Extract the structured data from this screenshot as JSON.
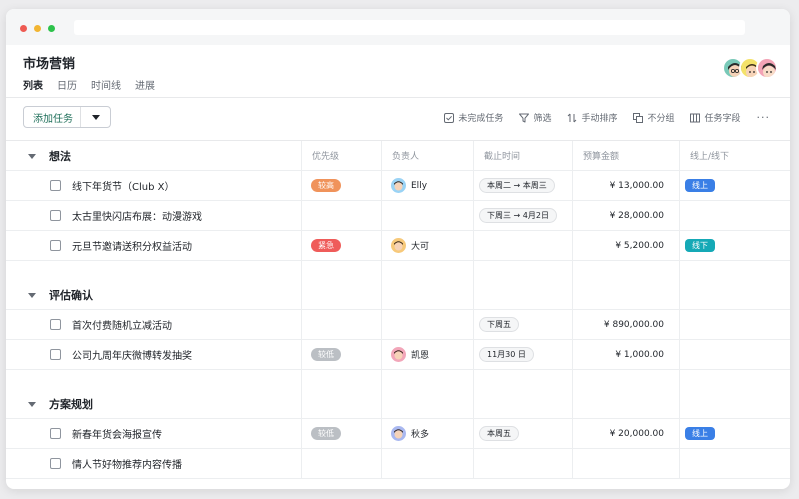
{
  "window": {},
  "page": {
    "title": "市场营销",
    "views": [
      {
        "label": "列表",
        "active": true
      },
      {
        "label": "日历",
        "active": false
      },
      {
        "label": "时间线",
        "active": false
      },
      {
        "label": "进展",
        "active": false
      }
    ]
  },
  "toolbar": {
    "add_task": "添加任务",
    "tools": [
      {
        "icon": "check-square-icon",
        "label": "未完成任务"
      },
      {
        "icon": "filter-icon",
        "label": "筛选"
      },
      {
        "icon": "sort-icon",
        "label": "手动排序"
      },
      {
        "icon": "group-icon",
        "label": "不分组"
      },
      {
        "icon": "columns-icon",
        "label": "任务字段"
      }
    ],
    "more": "···"
  },
  "columns": {
    "priority": "优先级",
    "owner": "负责人",
    "deadline": "截止时间",
    "budget": "预算金额",
    "channel": "线上/线下"
  },
  "colors": {
    "priority_high": "#f0935b",
    "priority_urgent": "#ef5c5a",
    "priority_low": "#bbbfc4",
    "online": "#3a7fe6",
    "offline": "#15a9b6"
  },
  "groups": [
    {
      "title": "想法",
      "tasks": [
        {
          "name": "线下年货节（Club X）",
          "priority": "较高",
          "priority_color": "#f0935b",
          "owner": "Elly",
          "deadline": "本周二 → 本周三",
          "budget": "¥ 13,000.00",
          "channel": "线上",
          "channel_color": "#3a7fe6"
        },
        {
          "name": "太古里快闪店布展：动漫游戏",
          "priority": "",
          "owner": "",
          "deadline": "下周三 → 4月2日",
          "budget": "¥ 28,000.00",
          "channel": ""
        },
        {
          "name": "元旦节邀请送积分权益活动",
          "priority": "紧急",
          "priority_color": "#ef5c5a",
          "owner": "大可",
          "deadline": "",
          "budget": "¥ 5,200.00",
          "channel": "线下",
          "channel_color": "#15a9b6"
        }
      ]
    },
    {
      "title": "评估确认",
      "tasks": [
        {
          "name": "首次付费随机立减活动",
          "priority": "",
          "owner": "",
          "deadline": "下周五",
          "budget": "¥ 890,000.00",
          "channel": ""
        },
        {
          "name": "公司九周年庆微博转发抽奖",
          "priority": "较低",
          "priority_color": "#bbbfc4",
          "owner": "凯恩",
          "deadline": "11月30 日",
          "budget": "¥ 1,000.00",
          "channel": ""
        }
      ]
    },
    {
      "title": "方案规划",
      "tasks": [
        {
          "name": "新春年货会海报宣传",
          "priority": "较低",
          "priority_color": "#bbbfc4",
          "owner": "秋多",
          "deadline": "本周五",
          "budget": "¥ 20,000.00",
          "channel": "线上",
          "channel_color": "#3a7fe6"
        },
        {
          "name": "情人节好物推荐内容传播",
          "priority": "",
          "owner": "",
          "deadline": "",
          "budget": "",
          "channel": ""
        }
      ]
    }
  ]
}
